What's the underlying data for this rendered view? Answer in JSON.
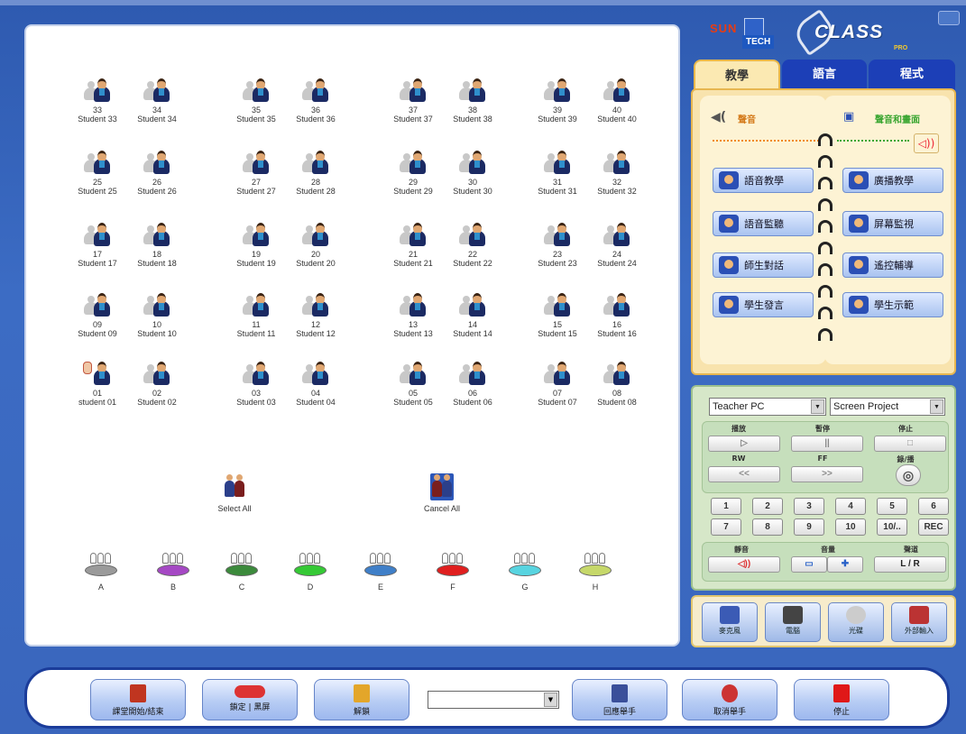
{
  "seats": [
    {
      "num": "33",
      "name": "Student 33"
    },
    {
      "num": "34",
      "name": "Student 34"
    },
    {
      "num": "35",
      "name": "Student 35"
    },
    {
      "num": "36",
      "name": "Student 36"
    },
    {
      "num": "37",
      "name": "Student 37"
    },
    {
      "num": "38",
      "name": "Student 38"
    },
    {
      "num": "39",
      "name": "Student 39"
    },
    {
      "num": "40",
      "name": "Student 40"
    },
    {
      "num": "25",
      "name": "Student 25"
    },
    {
      "num": "26",
      "name": "Student 26"
    },
    {
      "num": "27",
      "name": "Student 27"
    },
    {
      "num": "28",
      "name": "Student 28"
    },
    {
      "num": "29",
      "name": "Student 29"
    },
    {
      "num": "30",
      "name": "Student 30"
    },
    {
      "num": "31",
      "name": "Student 31"
    },
    {
      "num": "32",
      "name": "Student 32"
    },
    {
      "num": "17",
      "name": "Student 17"
    },
    {
      "num": "18",
      "name": "Student 18"
    },
    {
      "num": "19",
      "name": "Student 19"
    },
    {
      "num": "20",
      "name": "Student 20"
    },
    {
      "num": "21",
      "name": "Student 21"
    },
    {
      "num": "22",
      "name": "Student 22"
    },
    {
      "num": "23",
      "name": "Student 23"
    },
    {
      "num": "24",
      "name": "Student 24"
    },
    {
      "num": "09",
      "name": "Student 09"
    },
    {
      "num": "10",
      "name": "Student 10"
    },
    {
      "num": "11",
      "name": "Student 11"
    },
    {
      "num": "12",
      "name": "Student 12"
    },
    {
      "num": "13",
      "name": "Student 13"
    },
    {
      "num": "14",
      "name": "Student 14"
    },
    {
      "num": "15",
      "name": "Student 15"
    },
    {
      "num": "16",
      "name": "Student 16"
    },
    {
      "num": "01",
      "name": "student 01"
    },
    {
      "num": "02",
      "name": "Student 02"
    },
    {
      "num": "03",
      "name": "Student 03"
    },
    {
      "num": "04",
      "name": "Student 04"
    },
    {
      "num": "05",
      "name": "Student 05"
    },
    {
      "num": "06",
      "name": "Student 06"
    },
    {
      "num": "07",
      "name": "Student 07"
    },
    {
      "num": "08",
      "name": "Student 08"
    }
  ],
  "select_all": "Select All",
  "cancel_all": "Cancel All",
  "groups": [
    {
      "label": "A",
      "color": "#9a9a9a"
    },
    {
      "label": "B",
      "color": "#a548c4"
    },
    {
      "label": "C",
      "color": "#3c8a3c"
    },
    {
      "label": "D",
      "color": "#35c935"
    },
    {
      "label": "E",
      "color": "#3f7fc8"
    },
    {
      "label": "F",
      "color": "#e01f1f"
    },
    {
      "label": "G",
      "color": "#58d4e0"
    },
    {
      "label": "H",
      "color": "#c6d86a"
    }
  ],
  "logo": {
    "sun": "SUN",
    "tech": "TECH",
    "xclass": "CLASS",
    "pro": "PRO"
  },
  "tabs": [
    "教學",
    "語言",
    "程式"
  ],
  "modes": {
    "audio": "聲音",
    "audio_video": "聲音和畫面"
  },
  "book_buttons": [
    "語音教學",
    "廣播教學",
    "語音監聽",
    "屏幕監視",
    "師生對話",
    "遙控輔導",
    "學生發言",
    "學生示範"
  ],
  "player": {
    "source": "Teacher PC",
    "target": "Screen Project",
    "labels": [
      "播放",
      "暫停",
      "停止",
      "RW",
      "FF",
      "錄/播"
    ],
    "play_icon": "▷",
    "pause_icon": "||",
    "stop_icon": "□",
    "rw_icon": "<<",
    "ff_icon": ">>",
    "record_icon": "◎",
    "numbers": [
      "1",
      "2",
      "3",
      "4",
      "5",
      "6",
      "7",
      "8",
      "9",
      "10",
      "10/..",
      "REC"
    ],
    "mute": "靜音",
    "volume": "音量",
    "swap": "聲道",
    "lr": "L / R",
    "minus": "▭",
    "plus": "✚",
    "mute_icon": "◁))"
  },
  "sources": [
    "麥克風",
    "電腦",
    "光碟",
    "外部輸入"
  ],
  "bottom": {
    "class_start": "課堂開始/結束",
    "lock": "鎖定",
    "unlock": "黑屏",
    "release": "解鎖",
    "hand_raise": "回應舉手",
    "cancel_hand": "取消舉手",
    "stop": "停止"
  }
}
